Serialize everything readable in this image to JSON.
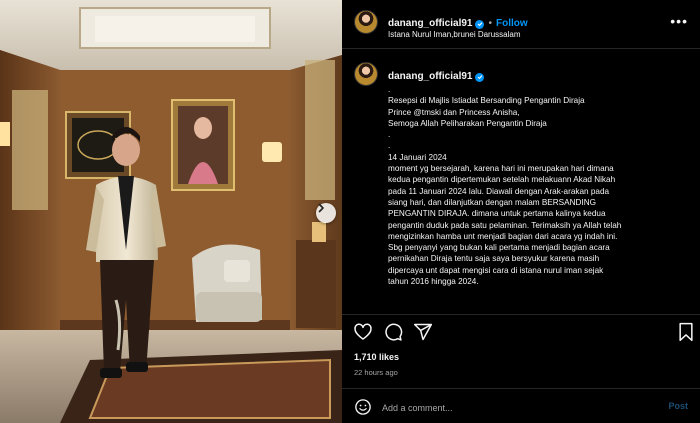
{
  "photo": {
    "alt_icon": "photo",
    "next_icon": "chevron-right-icon"
  },
  "header": {
    "username": "danang_official91",
    "separator": "•",
    "follow_label": "Follow",
    "location": "Istana Nurul Iman,brunei Darussalam",
    "more_icon": "more-horizontal-icon"
  },
  "caption": {
    "username": "danang_official91",
    "lines": [
      ".",
      "Resepsi di Majlis Istiadat Bersanding Pengantin Diraja",
      "Prince @tmski dan Princess Anisha,",
      "Semoga Allah Peliharakan Pengantin Diraja",
      ".",
      ".",
      "14 Januari 2024",
      "moment yg bersejarah, karena hari ini merupakan hari dimana",
      "kedua pengantin dipertemukan setelah melakuann Akad Nikah",
      "pada 11 Januari 2024 lalu. Diawali dengan Arak-arakan pada",
      "siang hari, dan dilanjutkan dengan malam BERSANDING",
      "PENGANTIN DIRAJA. dimana untuk pertama kalinya kedua",
      "pengantin duduk pada satu pelaminan. Terimaksih ya Allah telah",
      "mengizinkan hamba unt menjadi bagian dari acara yg indah ini.",
      "Sbg penyanyi yang bukan kali pertama menjadi bagian acara",
      "pernikahan Diraja tentu saja saya bersyukur karena masih",
      "dipercaya unt dapat mengisi cara di istana nurul iman sejak",
      "tahun 2016 hingga 2024."
    ]
  },
  "actions": {
    "like_icon": "heart-icon",
    "comment_icon": "comment-icon",
    "share_icon": "share-icon",
    "save_icon": "bookmark-icon"
  },
  "stats": {
    "likes": "1,710 likes",
    "time": "22 hours ago"
  },
  "comment": {
    "placeholder": "Add a comment...",
    "post_label": "Post",
    "emoji_icon": "emoji-icon"
  },
  "colors": {
    "background": "#000000",
    "text": "#f5f5f5",
    "muted": "#a8a8a8",
    "accent": "#0095f6",
    "post_disabled": "#1d4e74"
  }
}
